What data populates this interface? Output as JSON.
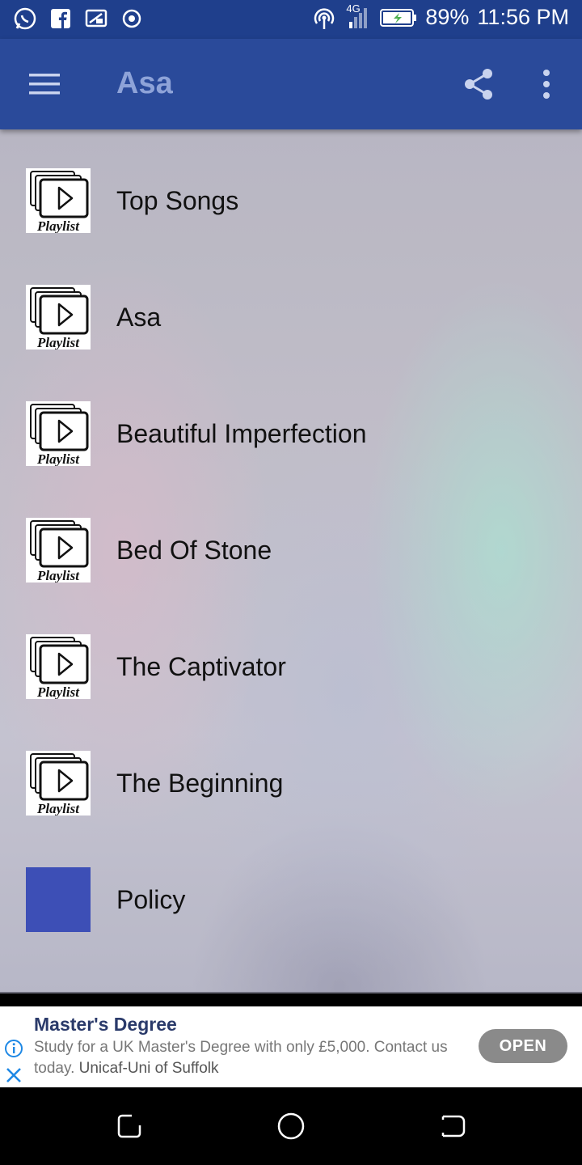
{
  "status_bar": {
    "network": "4G",
    "battery_percent": "89%",
    "time": "11:56 PM",
    "icons": [
      "whatsapp-icon",
      "facebook-icon",
      "cast-icon",
      "target-icon",
      "hotspot-icon",
      "signal-icon",
      "battery-icon"
    ]
  },
  "app_bar": {
    "title": "Asa",
    "icons": [
      "menu-icon",
      "share-icon",
      "more-vert-icon"
    ]
  },
  "playlist_thumb_text": "Playlist",
  "list": {
    "items": [
      {
        "label": "Top Songs",
        "thumb": "playlist"
      },
      {
        "label": "Asa",
        "thumb": "playlist"
      },
      {
        "label": "Beautiful Imperfection",
        "thumb": "playlist"
      },
      {
        "label": "Bed Of Stone",
        "thumb": "playlist"
      },
      {
        "label": "The Captivator",
        "thumb": "playlist"
      },
      {
        "label": "The Beginning",
        "thumb": "playlist"
      },
      {
        "label": "Policy",
        "thumb": "blank"
      }
    ]
  },
  "ad": {
    "title": "Master's Degree",
    "body": "Study for a UK Master's Degree with only £5,000. Contact us today.",
    "advertiser": "Unicaf-Uni of Suffolk",
    "button": "OPEN"
  },
  "colors": {
    "status_bar": "#1f3f8c",
    "app_bar": "#2a4a9a",
    "title": "#8ea3d8",
    "policy_thumb": "#3d4fb6",
    "ad_button": "#8a8a8a"
  }
}
